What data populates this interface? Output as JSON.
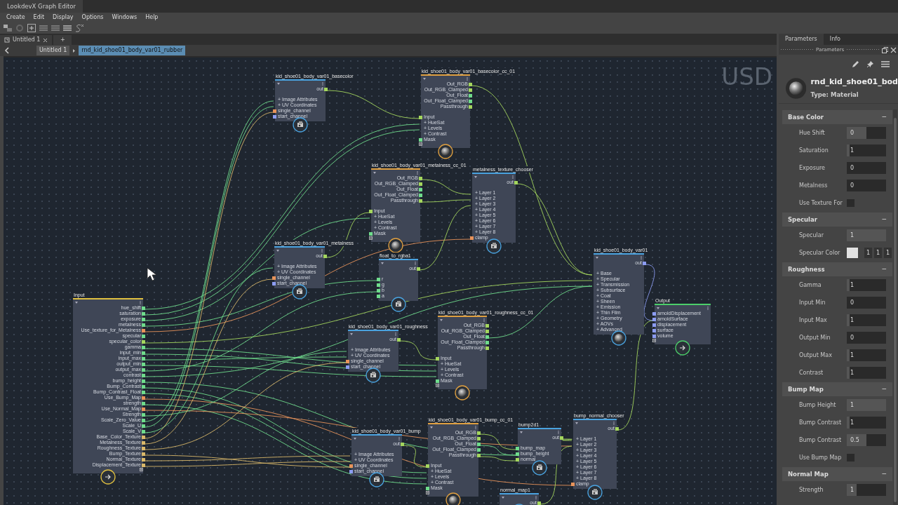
{
  "window": {
    "title": "LookdevX Graph Editor"
  },
  "menu": [
    "Create",
    "Edit",
    "Display",
    "Options",
    "Windows",
    "Help"
  ],
  "document_tabs": [
    {
      "label": "Untitled 1",
      "selected": true
    }
  ],
  "new_tab": "+",
  "breadcrumb": [
    {
      "label": "Untitled 1",
      "selected": false
    },
    {
      "label": "rnd_kid_shoe01_body_var01_rubber",
      "selected": true
    }
  ],
  "canvas": {
    "label": "USD",
    "nodes": [
      {
        "title": "kid_shoe01_body_var01_basecolor",
        "kind": "texture",
        "outputs": [
          {
            "label": "out",
            "color": "#a4d65e"
          }
        ],
        "inputs": [
          {
            "label": "+ Image Attributes"
          },
          {
            "label": "+ UV Coordinates"
          },
          {
            "label": "single_channel",
            "color": "#e8935a"
          },
          {
            "label": "start_channel",
            "color": "#8c9cf2"
          }
        ]
      },
      {
        "title": "kid_shoe01_body_var01_basecolor_cc_01",
        "kind": "colorcorrect",
        "add_port": true,
        "outputs": [
          {
            "label": "Out_RGB",
            "color": "#a4d65e"
          },
          {
            "label": "Out_RGB_Clamped",
            "color": "#a4d65e"
          },
          {
            "label": "Out_Float",
            "color": "#6fdc8c"
          },
          {
            "label": "Out_Float_Clamped",
            "color": "#6fdc8c"
          },
          {
            "label": "Passthrough",
            "color": "#a4d65e"
          }
        ],
        "inputs": [
          {
            "label": "Input",
            "color": "#a4d65e"
          },
          {
            "label": "+ HueSat"
          },
          {
            "label": "+ Levels"
          },
          {
            "label": "+ Contrast"
          },
          {
            "label": "Mask",
            "color": "#6fdc8c"
          }
        ]
      },
      {
        "title": "kid_shoe01_body_var01_metalness_cc_01",
        "kind": "colorcorrect",
        "add_port": true,
        "outputs": [
          {
            "label": "Out_RGB",
            "color": "#a4d65e"
          },
          {
            "label": "Out_RGB_Clamped",
            "color": "#a4d65e"
          },
          {
            "label": "Out_Float",
            "color": "#6fdc8c"
          },
          {
            "label": "Out_Float_Clamped",
            "color": "#6fdc8c"
          },
          {
            "label": "Passthrough",
            "color": "#a4d65e"
          }
        ],
        "inputs": [
          {
            "label": "Input",
            "color": "#a4d65e"
          },
          {
            "label": "+ HueSat"
          },
          {
            "label": "+ Levels"
          },
          {
            "label": "+ Contrast"
          },
          {
            "label": "Mask",
            "color": "#6fdc8c"
          }
        ]
      },
      {
        "title": "metalness_texture_chooser",
        "kind": "texture",
        "outputs": [
          {
            "label": "out",
            "color": "#a4d65e"
          }
        ],
        "inputs": [
          {
            "label": "+ Layer 1"
          },
          {
            "label": "+ Layer 2"
          },
          {
            "label": "+ Layer 3"
          },
          {
            "label": "+ Layer 4"
          },
          {
            "label": "+ Layer 5"
          },
          {
            "label": "+ Layer 6"
          },
          {
            "label": "+ Layer 7"
          },
          {
            "label": "+ Layer 8"
          },
          {
            "label": "clamp",
            "color": "#e8935a"
          }
        ]
      },
      {
        "title": "kid_shoe01_body_var01_metalness",
        "kind": "texture",
        "outputs": [
          {
            "label": "out",
            "color": "#a4d65e"
          }
        ],
        "inputs": [
          {
            "label": "+ Image Attributes"
          },
          {
            "label": "+ UV Coordinates"
          },
          {
            "label": "single_channel",
            "color": "#e8935a"
          },
          {
            "label": "start_channel",
            "color": "#8c9cf2"
          }
        ]
      },
      {
        "title": "float_to_rgba1",
        "kind": "texture",
        "outputs": [
          {
            "label": "out",
            "color": "#a4d65e"
          }
        ],
        "inputs": [
          {
            "label": "r",
            "color": "#6fdc8c"
          },
          {
            "label": "g",
            "color": "#6fdc8c"
          },
          {
            "label": "b",
            "color": "#6fdc8c"
          },
          {
            "label": "a",
            "color": "#6fdc8c"
          }
        ]
      },
      {
        "title": "Input",
        "kind": "input",
        "add_port": true,
        "outputs": [
          {
            "label": "hue_shift",
            "color": "#6fdc8c"
          },
          {
            "label": "saturation",
            "color": "#6fdc8c"
          },
          {
            "label": "exposure",
            "color": "#6fdc8c"
          },
          {
            "label": "metalness",
            "color": "#6fdc8c"
          },
          {
            "label": "Use_texture_for_Metalness",
            "color": "#e8935a"
          },
          {
            "label": "specular",
            "color": "#6fdc8c"
          },
          {
            "label": "specular_color",
            "color": "#a4d65e"
          },
          {
            "label": "gamma",
            "color": "#6fdc8c"
          },
          {
            "label": "input_min",
            "color": "#6fdc8c"
          },
          {
            "label": "input_max",
            "color": "#6fdc8c"
          },
          {
            "label": "output_min",
            "color": "#6fdc8c"
          },
          {
            "label": "output_max",
            "color": "#6fdc8c"
          },
          {
            "label": "contrast",
            "color": "#6fdc8c"
          },
          {
            "label": "bump_height",
            "color": "#6fdc8c"
          },
          {
            "label": "Bump_Contrast",
            "color": "#6fdc8c"
          },
          {
            "label": "Bump_Contrast_Float",
            "color": "#6fdc8c"
          },
          {
            "label": "Use_Bump_Map",
            "color": "#e8935a"
          },
          {
            "label": "strength",
            "color": "#6fdc8c"
          },
          {
            "label": "Use_Normal_Map",
            "color": "#e8935a"
          },
          {
            "label": "Strength",
            "color": "#6fdc8c"
          },
          {
            "label": "Scale_Zero_Value",
            "color": "#6fdc8c"
          },
          {
            "label": "Scale_U",
            "color": "#6fdc8c"
          },
          {
            "label": "Scale_V",
            "color": "#6fdc8c"
          },
          {
            "label": "Base_Color_Texture",
            "color": "#d9b86a"
          },
          {
            "label": "Metalness_Texture",
            "color": "#d9b86a"
          },
          {
            "label": "Roughness_Texture",
            "color": "#d9b86a"
          },
          {
            "label": "Bump_Texture",
            "color": "#d9b86a"
          },
          {
            "label": "Normal_Texture",
            "color": "#d9b86a"
          },
          {
            "label": "Displacement_Texture",
            "color": "#d9b86a"
          }
        ]
      },
      {
        "title": "kid_shoe01_body_var01_roughness",
        "kind": "texture",
        "outputs": [
          {
            "label": "out",
            "color": "#a4d65e"
          }
        ],
        "inputs": [
          {
            "label": "+ Image Attributes"
          },
          {
            "label": "+ UV Coordinates"
          },
          {
            "label": "single_channel",
            "color": "#e8935a"
          },
          {
            "label": "start_channel",
            "color": "#8c9cf2"
          }
        ]
      },
      {
        "title": "kid_shoe01_body_var01_roughness_cc_01",
        "kind": "colorcorrect",
        "add_port": true,
        "outputs": [
          {
            "label": "Out_RGB",
            "color": "#a4d65e"
          },
          {
            "label": "Out_RGB_Clamped",
            "color": "#a4d65e"
          },
          {
            "label": "Out_Float",
            "color": "#6fdc8c"
          },
          {
            "label": "Out_Float_Clamped",
            "color": "#6fdc8c"
          },
          {
            "label": "Passthrough",
            "color": "#a4d65e"
          }
        ],
        "inputs": [
          {
            "label": "Input",
            "color": "#a4d65e"
          },
          {
            "label": "+ HueSat"
          },
          {
            "label": "+ Levels"
          },
          {
            "label": "+ Contrast"
          },
          {
            "label": "Mask",
            "color": "#6fdc8c"
          }
        ]
      },
      {
        "title": "kid_shoe01_body_var01",
        "kind": "material",
        "outputs": [
          {
            "label": "out",
            "color": "#8c9cf2"
          }
        ],
        "inputs": [
          {
            "label": "+ Base"
          },
          {
            "label": "+ Specular"
          },
          {
            "label": "+ Transmission"
          },
          {
            "label": "+ Subsurface"
          },
          {
            "label": "+ Coat"
          },
          {
            "label": "+ Sheen"
          },
          {
            "label": "+ Emission"
          },
          {
            "label": "+ Thin Film"
          },
          {
            "label": "+ Geometry"
          },
          {
            "label": "+ AOVs"
          },
          {
            "label": "+ Advanced"
          }
        ]
      },
      {
        "title": "Output",
        "kind": "output",
        "add_port": true,
        "inputs": [
          {
            "label": "arnoldDisplacement",
            "color": "#8c9cf2"
          },
          {
            "label": "arnoldSurface",
            "color": "#8c9cf2"
          },
          {
            "label": "displacement",
            "color": "#8c9cf2"
          },
          {
            "label": "surface",
            "color": "#8c9cf2"
          },
          {
            "label": "volume",
            "color": "#8c9cf2"
          }
        ]
      },
      {
        "title": "kid_shoe01_body_var01_bump",
        "kind": "texture",
        "outputs": [
          {
            "label": "out",
            "color": "#a4d65e"
          }
        ],
        "inputs": [
          {
            "label": "+ Image Attributes"
          },
          {
            "label": "+ UV Coordinates"
          },
          {
            "label": "single_channel",
            "color": "#e8935a"
          },
          {
            "label": "start_channel",
            "color": "#8c9cf2"
          }
        ]
      },
      {
        "title": "kid_shoe01_body_var01_bump_cc_01",
        "kind": "colorcorrect",
        "add_port": true,
        "outputs": [
          {
            "label": "Out_RGB",
            "color": "#a4d65e"
          },
          {
            "label": "Out_RGB_Clamped",
            "color": "#a4d65e"
          },
          {
            "label": "Out_Float",
            "color": "#6fdc8c"
          },
          {
            "label": "Out_Float_Clamped",
            "color": "#6fdc8c"
          },
          {
            "label": "Passthrough",
            "color": "#a4d65e"
          }
        ],
        "inputs": [
          {
            "label": "Input",
            "color": "#a4d65e"
          },
          {
            "label": "+ HueSat"
          },
          {
            "label": "+ Levels"
          },
          {
            "label": "+ Contrast"
          },
          {
            "label": "Mask",
            "color": "#6fdc8c"
          }
        ]
      },
      {
        "title": "bump2d1",
        "kind": "texture",
        "outputs": [
          {
            "label": "out",
            "color": "#a4d65e"
          }
        ],
        "inputs": [
          {
            "label": "bump_map",
            "color": "#6fdc8c"
          },
          {
            "label": "bump_height",
            "color": "#6fdc8c"
          },
          {
            "label": "normal",
            "color": "#a4d65e"
          }
        ]
      },
      {
        "title": "bump_normal_chooser",
        "kind": "texture",
        "outputs": [
          {
            "label": "out",
            "color": "#a4d65e"
          }
        ],
        "inputs": [
          {
            "label": "+ Layer 1"
          },
          {
            "label": "+ Layer 2"
          },
          {
            "label": "+ Layer 3"
          },
          {
            "label": "+ Layer 4"
          },
          {
            "label": "+ Layer 5"
          },
          {
            "label": "+ Layer 6"
          },
          {
            "label": "+ Layer 7"
          },
          {
            "label": "+ Layer 8"
          },
          {
            "label": "clamp",
            "color": "#e8935a"
          }
        ]
      },
      {
        "title": "normal_map1",
        "kind": "texture",
        "outputs": [
          {
            "label": "out",
            "color": "#a4d65e"
          }
        ]
      }
    ]
  },
  "panel": {
    "tabs": [
      {
        "label": "Parameters",
        "selected": true
      },
      {
        "label": "Info",
        "selected": false
      }
    ],
    "title": "Parameters",
    "material": {
      "name": "rnd_kid_shoe01_bod",
      "type": "Type: Material"
    },
    "sections": [
      {
        "title": "Base Color",
        "toggle": "−",
        "expanded": true,
        "rows": [
          {
            "kind": "slider",
            "label": "Hue Shift",
            "value": "0",
            "level": 0.5
          },
          {
            "kind": "slider",
            "label": "Saturation",
            "value": "1",
            "level": 0.08
          },
          {
            "kind": "number",
            "label": "Exposure",
            "value": "0"
          },
          {
            "kind": "number",
            "label": "Metalness",
            "value": "0"
          },
          {
            "kind": "checkbox",
            "label": "Use Texture For",
            "checked": false
          }
        ]
      },
      {
        "title": "Specular",
        "toggle": "−",
        "expanded": true,
        "rows": [
          {
            "kind": "slider",
            "label": "Specular",
            "value": "1",
            "level": 1
          },
          {
            "kind": "color",
            "label": "Specular Color",
            "values": [
              "1",
              "1",
              "1"
            ]
          }
        ]
      },
      {
        "title": "Roughness",
        "toggle": "−",
        "expanded": true,
        "rows": [
          {
            "kind": "slider",
            "label": "Gamma",
            "value": "1",
            "level": 0.08
          },
          {
            "kind": "number",
            "label": "Input Min",
            "value": "0"
          },
          {
            "kind": "slider",
            "label": "Input Max",
            "value": "1",
            "level": 0.08
          },
          {
            "kind": "number",
            "label": "Output Min",
            "value": "0"
          },
          {
            "kind": "slider",
            "label": "Output Max",
            "value": "1",
            "level": 0.08
          },
          {
            "kind": "slider",
            "label": "Contrast",
            "value": "1",
            "level": 0.08
          }
        ]
      },
      {
        "title": "Bump Map",
        "toggle": "−",
        "expanded": true,
        "rows": [
          {
            "kind": "slider",
            "label": "Bump Height",
            "value": "1",
            "level": 1
          },
          {
            "kind": "slider",
            "label": "Bump  Contrast",
            "value": "1",
            "level": 0.08
          },
          {
            "kind": "slider",
            "label": "Bump  Contrast",
            "value": "0.5",
            "level": 0.5
          },
          {
            "kind": "checkbox",
            "label": "Use  Bump  Map",
            "checked": false
          }
        ]
      },
      {
        "title": "Normal Map",
        "toggle": "−",
        "expanded": true,
        "rows": [
          {
            "kind": "slider",
            "label": "Strength",
            "value": "1",
            "level": 0.25
          }
        ]
      }
    ]
  }
}
